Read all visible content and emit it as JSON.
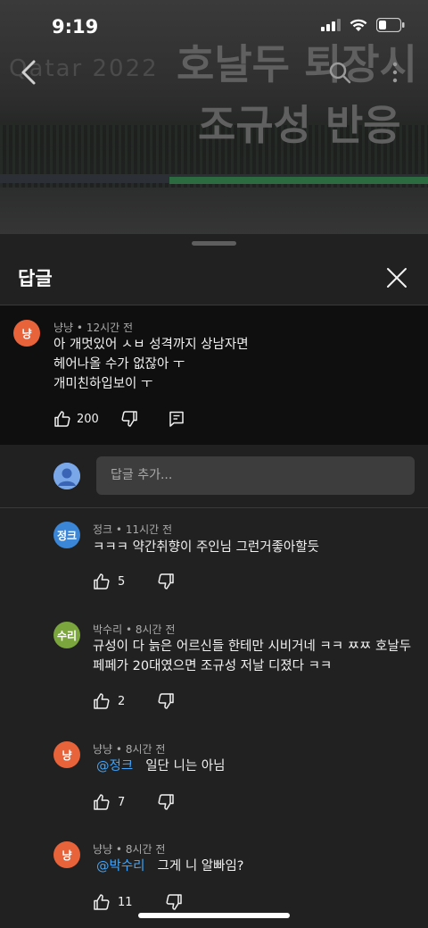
{
  "status_bar": {
    "time": "9:19"
  },
  "video": {
    "overlay_line1": "호날두 퇴장시",
    "overlay_line2": "조규성 반응",
    "faded_text": "Qatar 2022"
  },
  "sheet": {
    "title": "답글"
  },
  "parent_comment": {
    "avatar_text": "냥",
    "avatar_color": "#e8633a",
    "author": "냥냥",
    "time": "12시간 전",
    "lines": [
      "아 개멋있어 ㅅㅂ 성격까지 상남자면",
      "헤어나올 수가 없잖아 ㅜ",
      "개미친하입보이 ㅜ"
    ],
    "likes": "200"
  },
  "add_reply": {
    "placeholder": "답글 추가..."
  },
  "replies": [
    {
      "avatar_text": "정크",
      "avatar_color": "#3b86d6",
      "author": "정크",
      "time": "11시간 전",
      "mention": "",
      "lines": [
        "ㅋㅋㅋ 약간취향이 주인님 그런거좋아할듯"
      ],
      "likes": "5"
    },
    {
      "avatar_text": "수리",
      "avatar_color": "#7aa63d",
      "author": "박수리",
      "time": "8시간 전",
      "mention": "",
      "lines": [
        "규성이 다 늙은 어르신들 한테만 시비거네 ㅋㅋ ㅉㅉ 호날두",
        "페페가 20대였으면 조규성 저날 디졌다 ㅋㅋ"
      ],
      "likes": "2"
    },
    {
      "avatar_text": "냥",
      "avatar_color": "#e8633a",
      "author": "냥냥",
      "time": "8시간 전",
      "mention": "@정크",
      "lines": [
        "일단 니는 아님"
      ],
      "likes": "7"
    },
    {
      "avatar_text": "냥",
      "avatar_color": "#e8633a",
      "author": "냥냥",
      "time": "8시간 전",
      "mention": "@박수리",
      "lines": [
        "그게 니 알빠임?"
      ],
      "likes": "11"
    }
  ],
  "icons": {
    "back": "chevron-left-icon",
    "search": "search-icon",
    "more": "more-vertical-icon",
    "close": "close-icon",
    "like": "thumb-up-icon",
    "dislike": "thumb-down-icon",
    "reply": "reply-comment-icon"
  }
}
